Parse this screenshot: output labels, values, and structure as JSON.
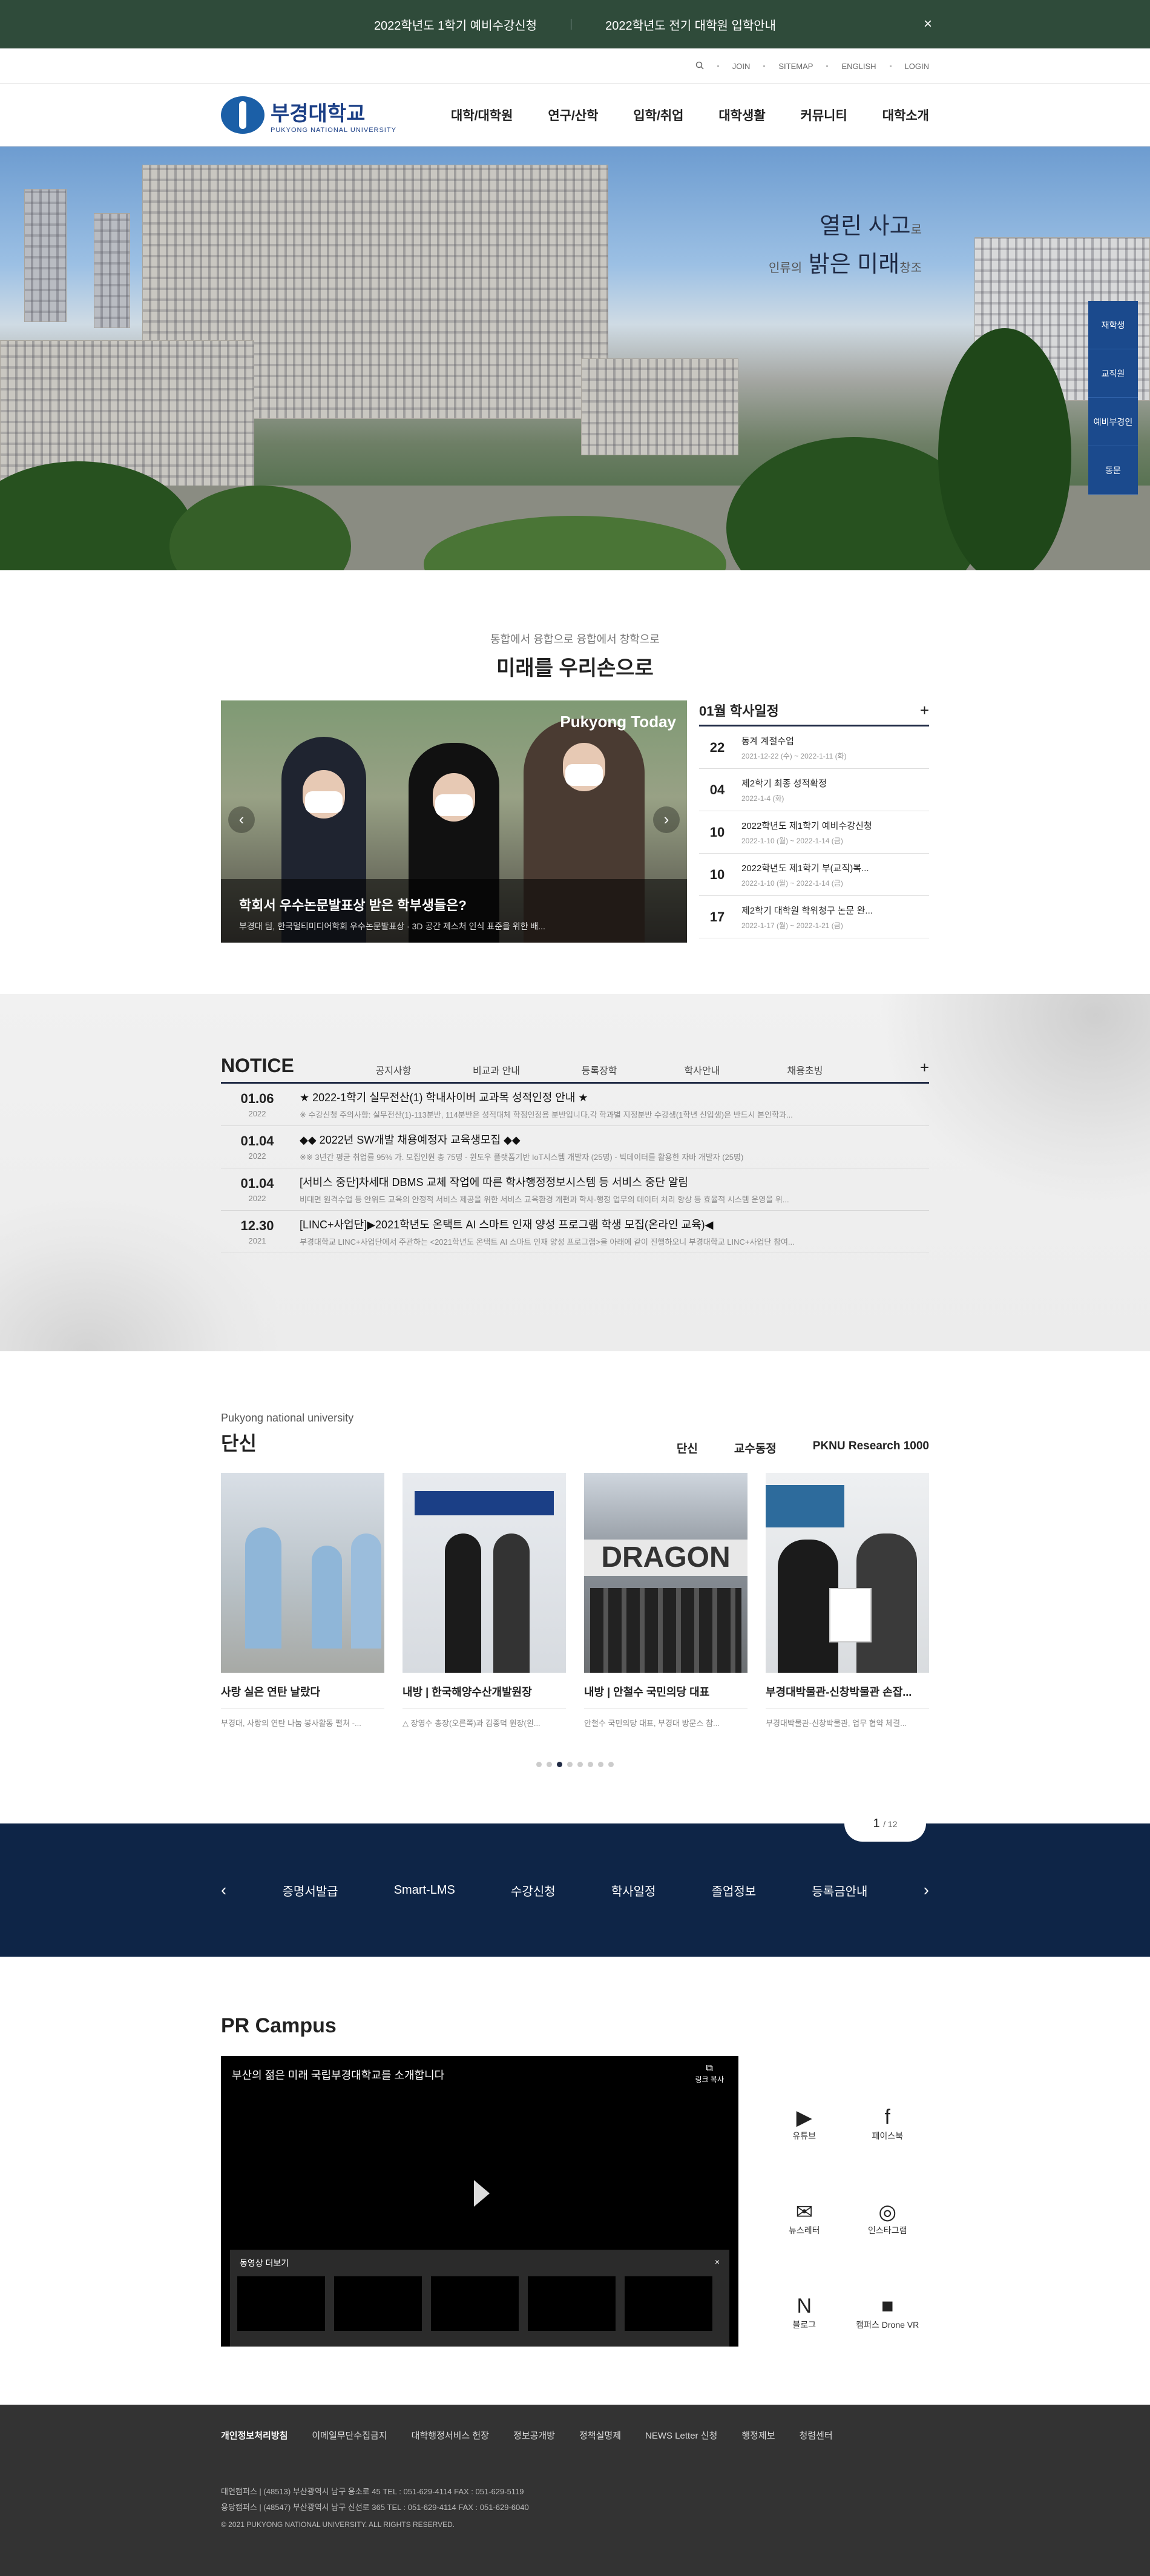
{
  "topbar": {
    "notice1": "2022학년도 1학기 예비수강신청",
    "notice2": "2022학년도 전기 대학원 입학안내",
    "close": "×"
  },
  "util": {
    "search_icon": "search-icon",
    "links": [
      "JOIN",
      "SITEMAP",
      "ENGLISH",
      "LOGIN"
    ]
  },
  "header": {
    "logo_ko": "부경대학교",
    "logo_en": "PUKYONG NATIONAL UNIVERSITY",
    "menu": [
      "대학/대학원",
      "연구/산학",
      "입학/취업",
      "대학생활",
      "커뮤니티",
      "대학소개"
    ]
  },
  "hero": {
    "line1_a": "열린 사고",
    "line1_b": "로",
    "line2_a": "인류의",
    "line2_b": "밝은 미래",
    "line2_c": "창조",
    "quick": [
      "재학생",
      "교직원",
      "예비부경인",
      "동문"
    ]
  },
  "intro": {
    "sub": "통합에서 융합으로 융합에서 창학으로",
    "title": "미래를 우리손으로"
  },
  "today": {
    "label": "Pukyong Today",
    "title": "학회서 우수논문발표상 받은 학부생들은?",
    "desc": "부경대 팀, 한국멀티미디어학회 우수논문발표상 · 3D 공간 제스처 인식 표준을 위한 배..."
  },
  "calendar": {
    "title": "01월 학사일정",
    "plus": "+",
    "items": [
      {
        "day": "22",
        "title": "동계 계절수업",
        "date": "2021-12-22 (수) ~ 2022-1-11 (화)"
      },
      {
        "day": "04",
        "title": "제2학기 최종 성적확정",
        "date": "2022-1-4 (화)"
      },
      {
        "day": "10",
        "title": "2022학년도 제1학기 예비수강신청",
        "date": "2022-1-10 (월) ~ 2022-1-14 (금)"
      },
      {
        "day": "10",
        "title": "2022학년도 제1학기 부(교직)복...",
        "date": "2022-1-10 (월) ~ 2022-1-14 (금)"
      },
      {
        "day": "17",
        "title": "제2학기 대학원 학위청구 논문 완...",
        "date": "2022-1-17 (월) ~ 2022-1-21 (금)"
      }
    ]
  },
  "notice": {
    "title": "NOTICE",
    "plus": "+",
    "tabs": [
      "공지사항",
      "비교과 안내",
      "등록장학",
      "학사안내",
      "채용초빙"
    ],
    "rows": [
      {
        "date": "01.06",
        "year": "2022",
        "title": "★ 2022-1학기 실무전산(1) 학내사이버 교과목 성적인정 안내 ★",
        "sub": "※ 수강신청 주의사항: 실무전산(1)-113분반, 114분반은 성적대체 학점인정용 분반입니다.각 학과별 지정분반 수강생(1학년 신입생)은 반드시 본인학과..."
      },
      {
        "date": "01.04",
        "year": "2022",
        "title": "◆◆ 2022년 SW개발 채용예정자 교육생모집 ◆◆",
        "sub": "※※ 3년간 평균 취업률 95% 가. 모집인원 총 75명 - 윈도우 플랫폼기반 IoT시스템 개발자 (25명) - 빅데이터를 활용한 자바 개발자 (25명)"
      },
      {
        "date": "01.04",
        "year": "2022",
        "title": "[서비스 중단]차세대 DBMS 교체 작업에 따른 학사행정정보시스템 등 서비스 중단 알림",
        "sub": "비대면 원격수업 등 안위드 교육의 안정적 서비스 제공을 위한 서비스 교육환경 개편과 학사·행정 업무의 데이터 처리 향상 등 효율적 시스템 운영을 위..."
      },
      {
        "date": "12.30",
        "year": "2021",
        "title": "[LINC+사업단]▶2021학년도 온택트 AI 스마트 인재 양성 프로그램 학생 모집(온라인 교육)◀",
        "sub": "부경대학교 LINC+사업단에서 주관하는 <2021학년도 온택트 AI 스마트 인재 양성 프로그램>을 아래에 같이 진행하오니 부경대학교 LINC+사업단 참여..."
      }
    ]
  },
  "news": {
    "sub": "Pukyong national university",
    "title": "단신",
    "tabs": [
      "단신",
      "교수동정",
      "PKNU Research 1000"
    ],
    "cards": [
      {
        "title": "사랑 실은 연탄 날랐다",
        "desc": "부경대, 사랑의 연탄 나눔 봉사활동 펼쳐 -..."
      },
      {
        "title": "내방 | 한국해양수산개발원장",
        "desc": "△ 장영수 총장(오른쪽)과 김종덕 원장(왼..."
      },
      {
        "title": "내방 | 안철수 국민의당 대표",
        "desc": "안철수 국민의당 대표, 부경대 방문스 참..."
      },
      {
        "title": "부경대박물관-신창박물관 손잡...",
        "desc": "부경대박물관-신창박물관, 업무 협약 체결..."
      }
    ],
    "page": 3,
    "pages": 8
  },
  "band": {
    "page_cur": "1",
    "page_total": "/ 12",
    "links": [
      "증명서발급",
      "Smart-LMS",
      "수강신청",
      "학사일정",
      "졸업정보",
      "등록금안내"
    ],
    "prev": "‹",
    "next": "›"
  },
  "pr": {
    "title": "PR Campus",
    "video_title": "부산의 젊은 미래 국립부경대학교를 소개합니다",
    "copy": "링크 복사",
    "more": "동영상 더보기",
    "close": "×",
    "sns": [
      {
        "icon": "youtube-icon",
        "label": "유튜브"
      },
      {
        "icon": "facebook-icon",
        "label": "페이스북"
      },
      {
        "icon": "newsletter-icon",
        "label": "뉴스레터"
      },
      {
        "icon": "instagram-icon",
        "label": "인스타그램"
      },
      {
        "icon": "blog-icon",
        "label": "블로그"
      },
      {
        "icon": "drone-vr-icon",
        "label": "캠퍼스 Drone VR"
      }
    ]
  },
  "footer": {
    "links": [
      "개인정보처리방침",
      "이메일무단수집금지",
      "대학행정서비스 헌장",
      "정보공개방",
      "정책실명제",
      "NEWS Letter 신청",
      "행정제보",
      "청렴센터"
    ],
    "addr1": "대연캠퍼스 | (48513) 부산광역시 남구 용소로 45    TEL : 051-629-4114    FAX : 051-629-5119",
    "addr2": "용당캠퍼스 | (48547) 부산광역시 남구 신선로 365    TEL : 051-629-4114    FAX : 051-629-6040",
    "copyright": "© 2021 PUKYONG NATIONAL UNIVERSITY. ALL RIGHTS RESERVED."
  }
}
